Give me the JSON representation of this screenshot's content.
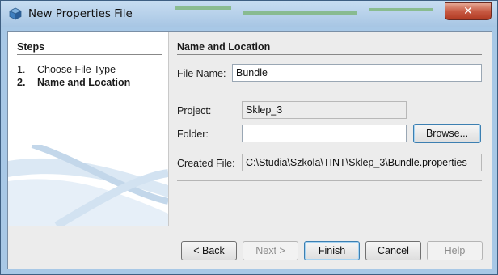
{
  "window": {
    "title": "New Properties File",
    "close_glyph": "✕"
  },
  "steps": {
    "title": "Steps",
    "items": [
      {
        "num": "1.",
        "label": "Choose File Type",
        "active": false
      },
      {
        "num": "2.",
        "label": "Name and Location",
        "active": true
      }
    ]
  },
  "form": {
    "title": "Name and Location",
    "file_name_label": "File Name:",
    "file_name_value": "Bundle",
    "project_label": "Project:",
    "project_value": "Sklep_3",
    "folder_label": "Folder:",
    "folder_value": "",
    "browse_label": "Browse...",
    "created_file_label": "Created File:",
    "created_file_value": "C:\\Studia\\Szkola\\TINT\\Sklep_3\\Bundle.properties"
  },
  "buttons": {
    "back": "< Back",
    "next": "Next >",
    "finish": "Finish",
    "cancel": "Cancel",
    "help": "Help"
  },
  "colors": {
    "title_bar": "#b9d3ee",
    "close": "#c75a43",
    "panel": "#ececec"
  },
  "icons": {
    "window": "netbeans-cube-icon",
    "close": "close-icon"
  }
}
